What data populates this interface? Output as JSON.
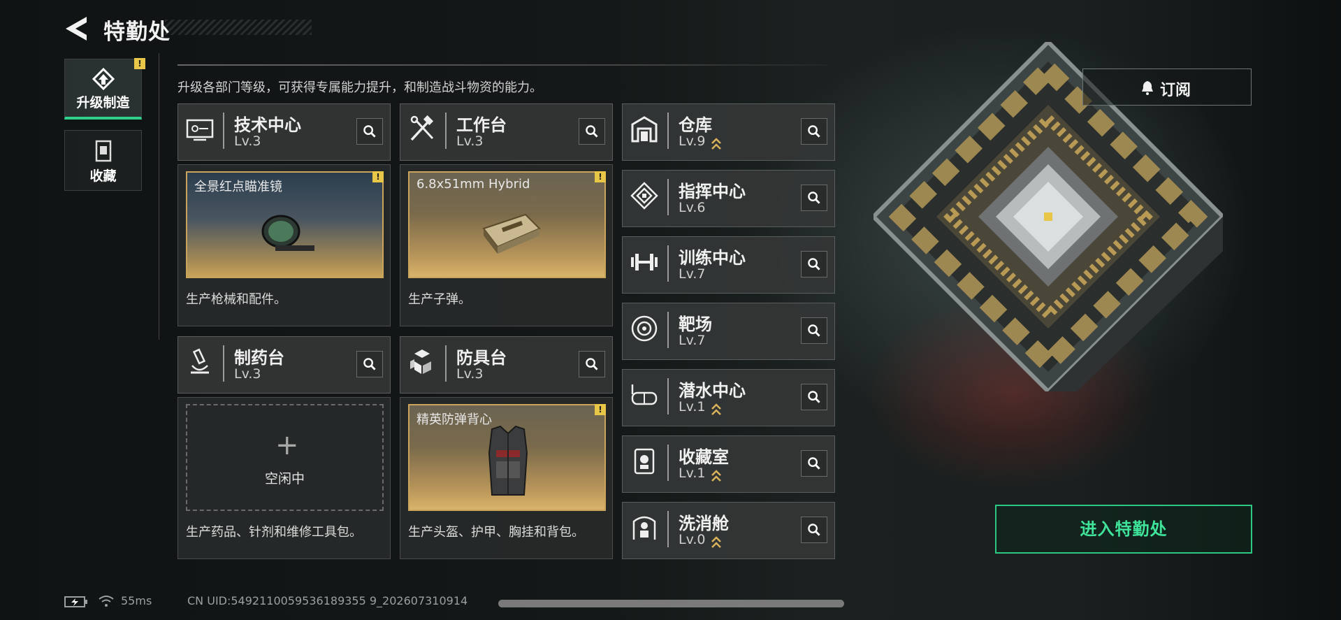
{
  "header": {
    "title": "特勤处"
  },
  "nav": [
    {
      "label": "升级制造",
      "active": true,
      "badge": "!"
    },
    {
      "label": "收藏",
      "active": false
    }
  ],
  "subtitle": "升级各部门等级，可获得专属能力提升，和制造战斗物资的能力。",
  "departments_main": [
    {
      "name": "技术中心",
      "level": "Lv.3",
      "icon": "monitor-icon",
      "product": {
        "name": "全景红点瞄准镜",
        "badge": "!"
      },
      "description": "生产枪械和配件。"
    },
    {
      "name": "工作台",
      "level": "Lv.3",
      "icon": "tools-icon",
      "product": {
        "name": "6.8x51mm Hybrid",
        "badge": "!"
      },
      "description": "生产子弹。"
    },
    {
      "name": "制药台",
      "level": "Lv.3",
      "icon": "microscope-icon",
      "idle": {
        "plus": "+",
        "label": "空闲中"
      },
      "description": "生产药品、针剂和维修工具包。"
    },
    {
      "name": "防具台",
      "level": "Lv.3",
      "icon": "armor-icon",
      "product": {
        "name": "精英防弹背心",
        "badge": "!"
      },
      "description": "生产头盔、护甲、胸挂和背包。"
    }
  ],
  "departments_side": [
    {
      "name": "仓库",
      "level": "Lv.9",
      "upgradable": true,
      "icon": "warehouse-icon"
    },
    {
      "name": "指挥中心",
      "level": "Lv.6",
      "upgradable": false,
      "icon": "chip-icon"
    },
    {
      "name": "训练中心",
      "level": "Lv.7",
      "upgradable": false,
      "icon": "dumbbell-icon"
    },
    {
      "name": "靶场",
      "level": "Lv.7",
      "upgradable": false,
      "icon": "target-icon"
    },
    {
      "name": "潜水中心",
      "level": "Lv.1",
      "upgradable": true,
      "icon": "diving-mask-icon"
    },
    {
      "name": "收藏室",
      "level": "Lv.1",
      "upgradable": true,
      "icon": "display-case-icon"
    },
    {
      "name": "洗消舱",
      "level": "Lv.0",
      "upgradable": true,
      "icon": "decon-chamber-icon"
    }
  ],
  "subscribe_label": "订阅",
  "enter_label": "进入特勤处",
  "footer": {
    "ping": "55ms",
    "uid": "CN UID:5492110059536189355 9_202607310914"
  },
  "colors": {
    "accent": "#2fd08a",
    "warning": "#e8c648",
    "upgrade": "#d9b25a"
  }
}
